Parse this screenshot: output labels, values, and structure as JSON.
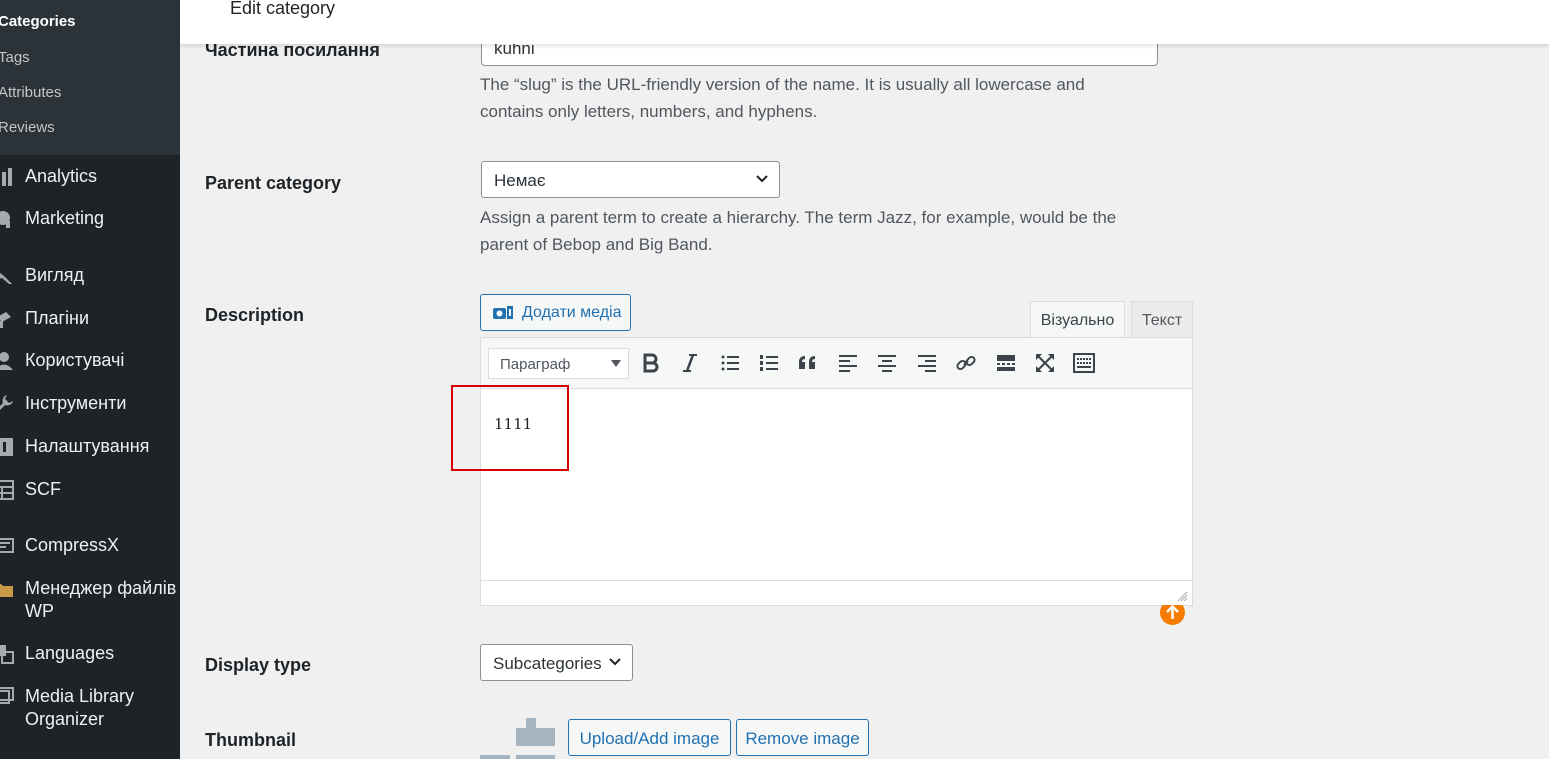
{
  "sidebar": {
    "submenu": [
      {
        "label": "Categories",
        "current": true
      },
      {
        "label": "Tags"
      },
      {
        "label": "Attributes"
      },
      {
        "label": "Reviews"
      }
    ],
    "menu": [
      {
        "label": "Analytics",
        "icon": "bar-chart-icon"
      },
      {
        "label": "Marketing",
        "icon": "megaphone-icon"
      },
      {
        "label": "Вигляд",
        "icon": "paintbrush-icon"
      },
      {
        "label": "Плагіни",
        "icon": "plugin-icon"
      },
      {
        "label": "Користувачі",
        "icon": "users-icon"
      },
      {
        "label": "Інструменти",
        "icon": "wrench-icon"
      },
      {
        "label": "Налаштування",
        "icon": "settings-icon"
      },
      {
        "label": "SCF",
        "icon": "table-icon"
      },
      {
        "label": "CompressX",
        "icon": "image-compress-icon"
      },
      {
        "label_line1": "Менеджер файлів",
        "label_line2": "WP",
        "icon": "folder-icon"
      },
      {
        "label": "Languages",
        "icon": "translate-icon"
      },
      {
        "label_line1": "Media Library",
        "label_line2": "Organizer",
        "icon": "media-organizer-icon"
      }
    ]
  },
  "header": {
    "title": "Edit category"
  },
  "form": {
    "slug": {
      "label": "Частина посилання",
      "value": "kuhni",
      "help_line1": "The “slug” is the URL-friendly version of the name. It is usually all lowercase and",
      "help_line2": "contains only letters, numbers, and hyphens."
    },
    "parent": {
      "label": "Parent category",
      "value": "Немає",
      "help_line1": "Assign a parent term to create a hierarchy. The term Jazz, for example, would be the",
      "help_line2": "parent of Bebop and Big Band."
    },
    "description": {
      "label": "Description",
      "add_media_label": "Додати медіа",
      "tab_visual": "Візуально",
      "tab_text": "Текст",
      "format_value": "Параграф",
      "content": "1111"
    },
    "display_type": {
      "label": "Display type",
      "value": "Subcategories"
    },
    "thumbnail": {
      "label": "Thumbnail",
      "upload_label": "Upload/Add image",
      "remove_label": "Remove image"
    }
  },
  "colors": {
    "sidebar_bg": "#1d2327",
    "accent": "#2271b1",
    "highlight": "#d60000",
    "grammar": "#f57c00"
  }
}
